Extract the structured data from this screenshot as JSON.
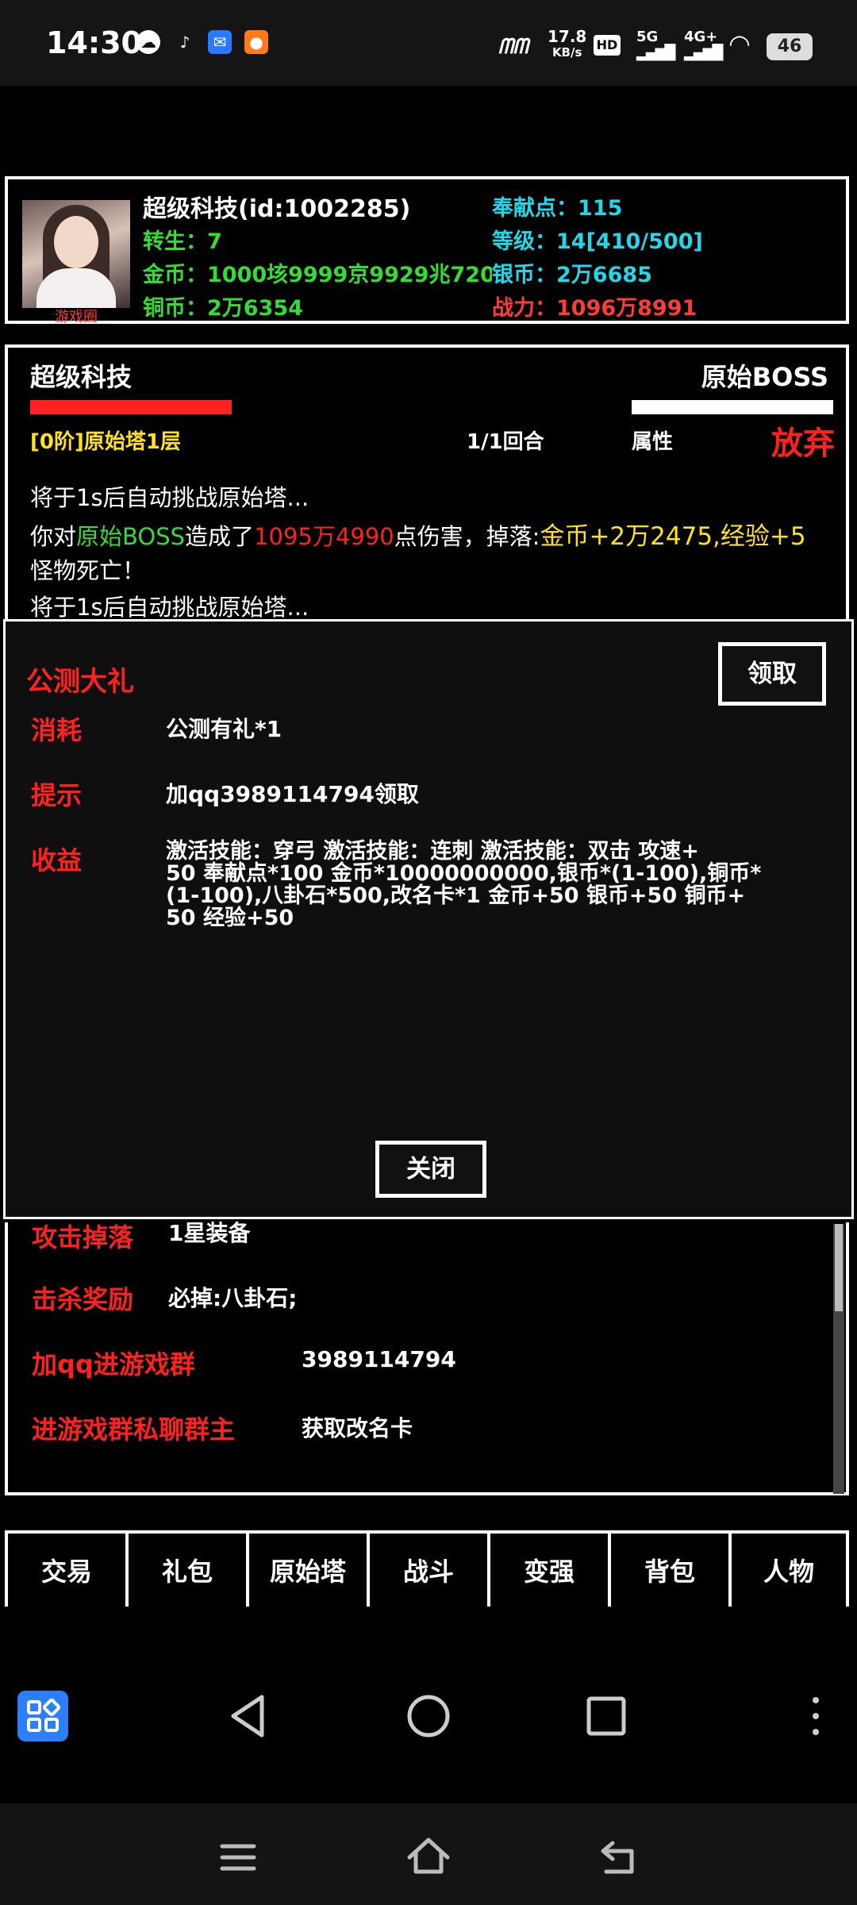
{
  "statusbar": {
    "time": "14:30",
    "net_speed_top": "17.8",
    "net_speed_bottom": "KB/s",
    "hd": "HD",
    "sig1": "5G",
    "sig2": "4G+",
    "battery": "46"
  },
  "player": {
    "avatar_tag": "游戏圈",
    "name": "超级科技(id:1002285)",
    "contribution": "奉献点：115",
    "rebirth": "转生：7",
    "level": "等级：14[410/500]",
    "gold": "金币：1000垓9999京9929兆7206",
    "silver": "银币：2万6685",
    "copper": "铜币：2万6354",
    "power": "战力：1096万8991"
  },
  "battle": {
    "player_name": "超级科技",
    "enemy_name": "原始BOSS",
    "stage": "[0阶]原始塔1层",
    "round": "1/1回合",
    "attr": "属性",
    "give_up": "放弃",
    "log1": "将于1s后自动挑战原始塔...",
    "log2_a": "你对",
    "log2_b": "原始BOSS",
    "log2_c": "造成了",
    "log2_d": "1095万4990",
    "log2_e": "点伤害，掉落:",
    "log2_f": "金币+2万2475,经验+5",
    "log3": "怪物死亡！",
    "log4": "将于1s后自动挑战原始塔..."
  },
  "modal": {
    "title": "公测大礼",
    "claim": "领取",
    "cost_label": "消耗",
    "cost_value": "公测有礼*1",
    "hint_label": "提示",
    "hint_value": "加qq3989114794领取",
    "reward_label": "收益",
    "reward_line1": "激活技能：穿弓 激活技能：连刺 激活技能：双击 攻速+",
    "reward_line2": "50 奉献点*100 金币*10000000000,银币*(1-100),铜币*",
    "reward_line3": "(1-100),八卦石*500,改名卡*1 金币+50 银币+50 铜币+",
    "reward_line4": "50 经验+50",
    "close": "关闭"
  },
  "info": {
    "drop_label": "攻击掉落",
    "drop_value": "1星装备",
    "kill_label": "击杀奖励",
    "kill_value": "必掉:八卦石;",
    "qq_label": "加qq进游戏群",
    "qq_value": "3989114794",
    "pm_label": "进游戏群私聊群主",
    "pm_value": "获取改名卡"
  },
  "tabs": [
    "交易",
    "礼包",
    "原始塔",
    "战斗",
    "变强",
    "背包",
    "人物"
  ],
  "colors": {
    "red": "#ff2020",
    "green": "#33dd33",
    "cyan": "#22d8e8",
    "yellow": "#ffe21a",
    "bright_red": "#ff3b3b"
  }
}
